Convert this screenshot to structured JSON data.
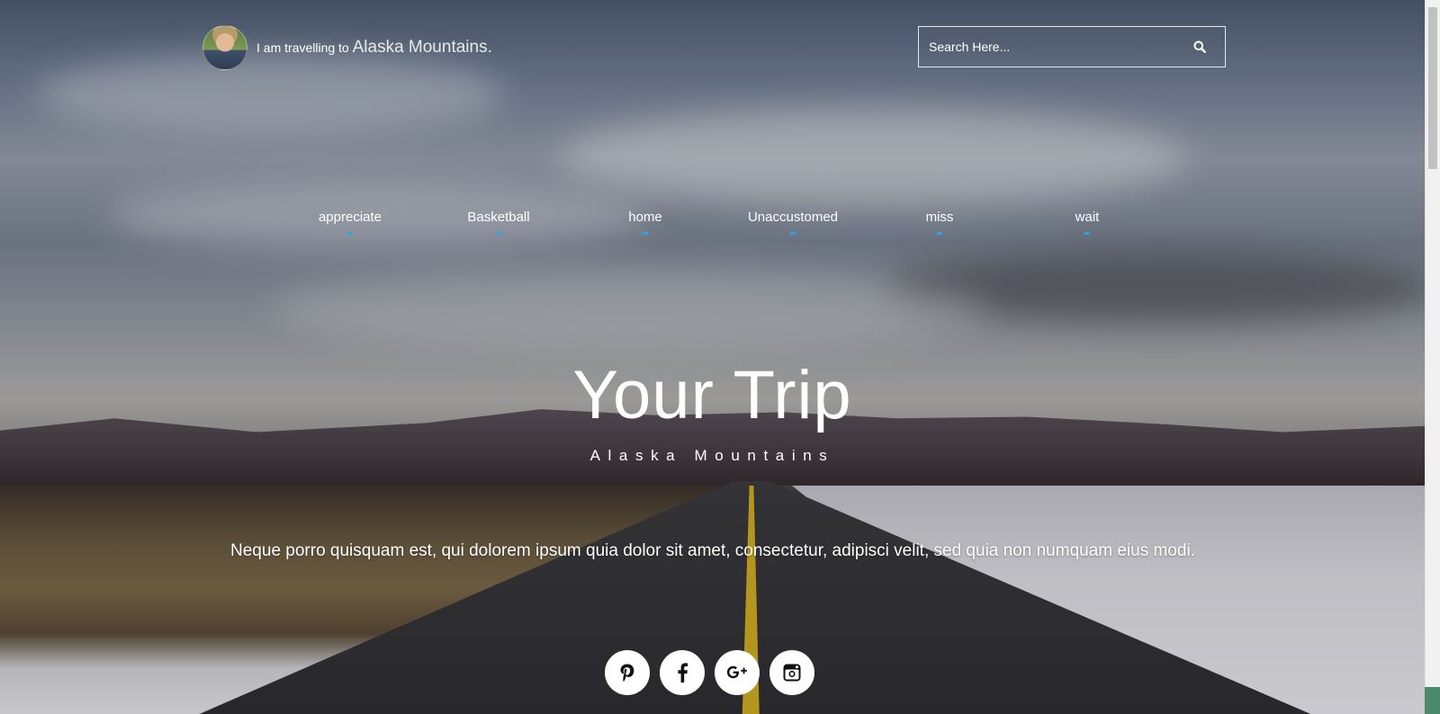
{
  "header": {
    "tagline_prefix": "I am travelling to",
    "destination": "Alaska Mountains."
  },
  "search": {
    "placeholder": "Search Here..."
  },
  "nav": {
    "items": [
      {
        "label": "appreciate"
      },
      {
        "label": "Basketball"
      },
      {
        "label": "home"
      },
      {
        "label": "Unaccustomed"
      },
      {
        "label": "miss"
      },
      {
        "label": "wait"
      }
    ],
    "indicator_color": "#2fa3e6"
  },
  "hero": {
    "title": "Your Trip",
    "subtitle": "Alaska Mountains",
    "description": "Neque porro quisquam est, qui dolorem ipsum quia dolor sit amet, consectetur, adipisci velit, sed quia non numquam eius modi."
  },
  "social": [
    {
      "name": "pinterest-icon",
      "glyph": "P"
    },
    {
      "name": "facebook-icon",
      "glyph": "f"
    },
    {
      "name": "google-plus-icon",
      "glyph": "g+"
    },
    {
      "name": "instagram-icon",
      "glyph": "camera"
    }
  ]
}
